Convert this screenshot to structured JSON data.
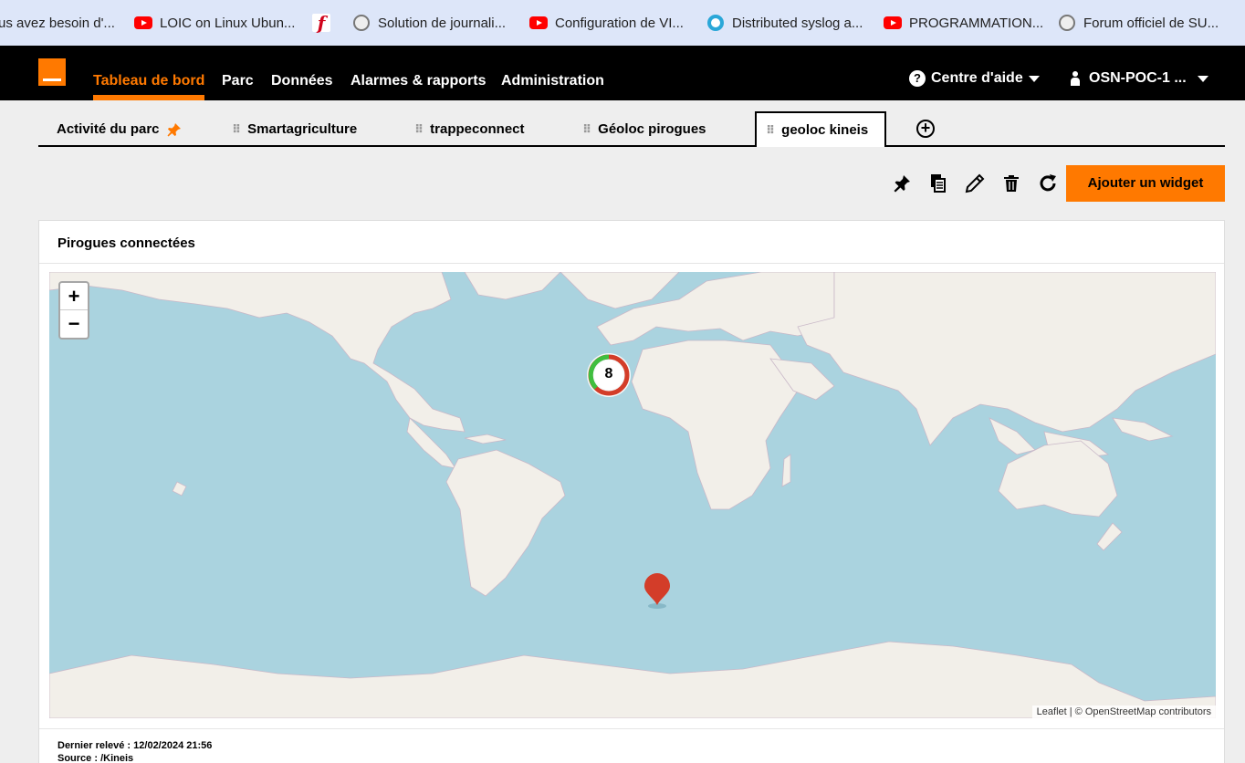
{
  "bookmarks": [
    {
      "label": "us avez besoin d'...",
      "icon": "none"
    },
    {
      "label": "LOIC on Linux Ubun...",
      "icon": "youtube-icon"
    },
    {
      "label": "",
      "icon": "flash-icon"
    },
    {
      "label": "Solution de journali...",
      "icon": "site-icon"
    },
    {
      "label": "Configuration de VI...",
      "icon": "youtube-icon"
    },
    {
      "label": "Distributed syslog a...",
      "icon": "circle-icon"
    },
    {
      "label": "PROGRAMMATION...",
      "icon": "youtube-icon"
    },
    {
      "label": "Forum officiel de SU...",
      "icon": "globe-icon"
    }
  ],
  "nav": {
    "items": [
      "Tableau de bord",
      "Parc",
      "Données",
      "Alarmes & rapports",
      "Administration"
    ],
    "active": "Tableau de bord",
    "help_label": "Centre d'aide",
    "user_label": "OSN-POC-1 ..."
  },
  "tabs": {
    "items": [
      "Activité du parc",
      "Smartagriculture",
      "trappeconnect",
      "Géoloc pirogues",
      "geoloc kineis"
    ],
    "active": "geoloc kineis"
  },
  "toolbar": {
    "add_widget_label": "Ajouter un widget",
    "icons": [
      "pin-icon",
      "copy-icon",
      "edit-icon",
      "delete-icon",
      "refresh-icon"
    ]
  },
  "widget": {
    "title": "Pirogues connectées",
    "map": {
      "zoom_in": "+",
      "zoom_out": "−",
      "cluster_count": "8",
      "attribution": "Leaflet | © OpenStreetMap contributors"
    },
    "footer": {
      "last_reading": "Dernier relevé : 12/02/2024 21:56",
      "source": "Source :   /Kineis"
    }
  },
  "colors": {
    "accent": "#ff7900",
    "nav_bg": "#000000",
    "map_water": "#aad3df",
    "map_land": "#f2efe9",
    "marker": "#d33d29"
  }
}
